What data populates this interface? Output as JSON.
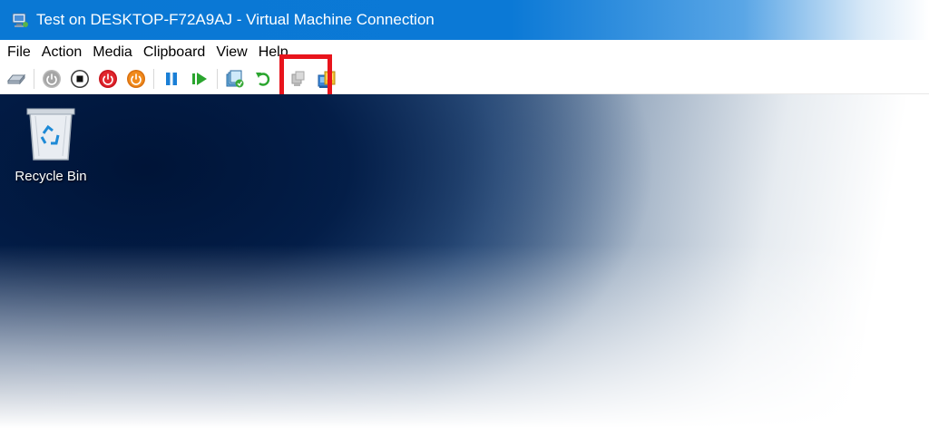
{
  "window": {
    "title": "Test on DESKTOP-F72A9AJ - Virtual Machine Connection",
    "title_icon": "vm-connection-icon"
  },
  "menubar": {
    "items": [
      {
        "label": "File"
      },
      {
        "label": "Action"
      },
      {
        "label": "Media"
      },
      {
        "label": "Clipboard"
      },
      {
        "label": "View"
      },
      {
        "label": "Help"
      }
    ]
  },
  "toolbar": {
    "buttons": [
      {
        "icon": "ctrl-alt-del-icon"
      },
      {
        "icon": "start-icon",
        "state": "disabled"
      },
      {
        "icon": "turn-off-icon"
      },
      {
        "icon": "shut-down-icon"
      },
      {
        "icon": "save-icon"
      },
      {
        "icon": "pause-icon"
      },
      {
        "icon": "resume-icon"
      },
      {
        "icon": "checkpoint-icon"
      },
      {
        "icon": "revert-icon"
      },
      {
        "icon": "enhanced-session-icon",
        "state": "disabled"
      },
      {
        "icon": "zoom-session-icon",
        "highlighted": true
      }
    ],
    "highlight_color": "#e8141c"
  },
  "desktop": {
    "icons": [
      {
        "label": "Recycle Bin",
        "icon": "recycle-bin-icon"
      }
    ]
  },
  "colors": {
    "titlebar": "#0a78d4",
    "desktop": "#0a2b5c"
  }
}
